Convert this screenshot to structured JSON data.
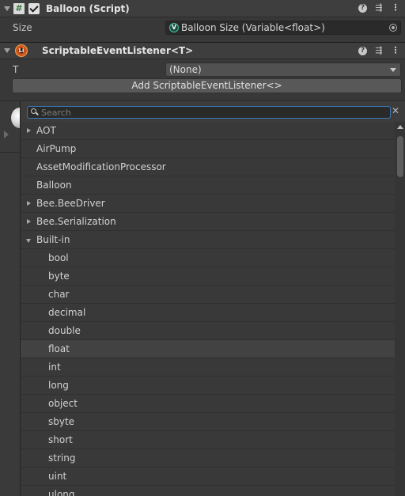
{
  "component1": {
    "icon": "script-icon",
    "title": "Balloon (Script)",
    "enabled": true
  },
  "size_row": {
    "label": "Size",
    "value": "Balloon Size (Variable<float>)",
    "value_icon": "variable-icon"
  },
  "component2": {
    "icon": "listener-icon",
    "title": "ScriptableEventListener<T>"
  },
  "t_row": {
    "label": "T",
    "value": "(None)"
  },
  "add_button": {
    "label": "Add ScriptableEventListener<>"
  },
  "search": {
    "placeholder": "Search"
  },
  "type_list": {
    "items": [
      {
        "label": "AOT",
        "expandable": true,
        "expanded": false,
        "level": 0
      },
      {
        "label": "AirPump",
        "expandable": false,
        "level": 0
      },
      {
        "label": "AssetModificationProcessor",
        "expandable": false,
        "level": 0
      },
      {
        "label": "Balloon",
        "expandable": false,
        "level": 0
      },
      {
        "label": "Bee.BeeDriver",
        "expandable": true,
        "expanded": false,
        "level": 0
      },
      {
        "label": "Bee.Serialization",
        "expandable": true,
        "expanded": false,
        "level": 0
      },
      {
        "label": "Built-in",
        "expandable": true,
        "expanded": true,
        "level": 0
      },
      {
        "label": "bool",
        "level": 1
      },
      {
        "label": "byte",
        "level": 1
      },
      {
        "label": "char",
        "level": 1
      },
      {
        "label": "decimal",
        "level": 1
      },
      {
        "label": "double",
        "level": 1
      },
      {
        "label": "float",
        "level": 1,
        "selected": true
      },
      {
        "label": "int",
        "level": 1
      },
      {
        "label": "long",
        "level": 1
      },
      {
        "label": "object",
        "level": 1
      },
      {
        "label": "sbyte",
        "level": 1
      },
      {
        "label": "short",
        "level": 1
      },
      {
        "label": "string",
        "level": 1
      },
      {
        "label": "uint",
        "level": 1
      },
      {
        "label": "ulong",
        "level": 1
      }
    ]
  },
  "colors": {
    "background": "#383838",
    "header": "#3e3e3e",
    "focus_outline": "#3a79bb",
    "selected_row": "#424242"
  }
}
